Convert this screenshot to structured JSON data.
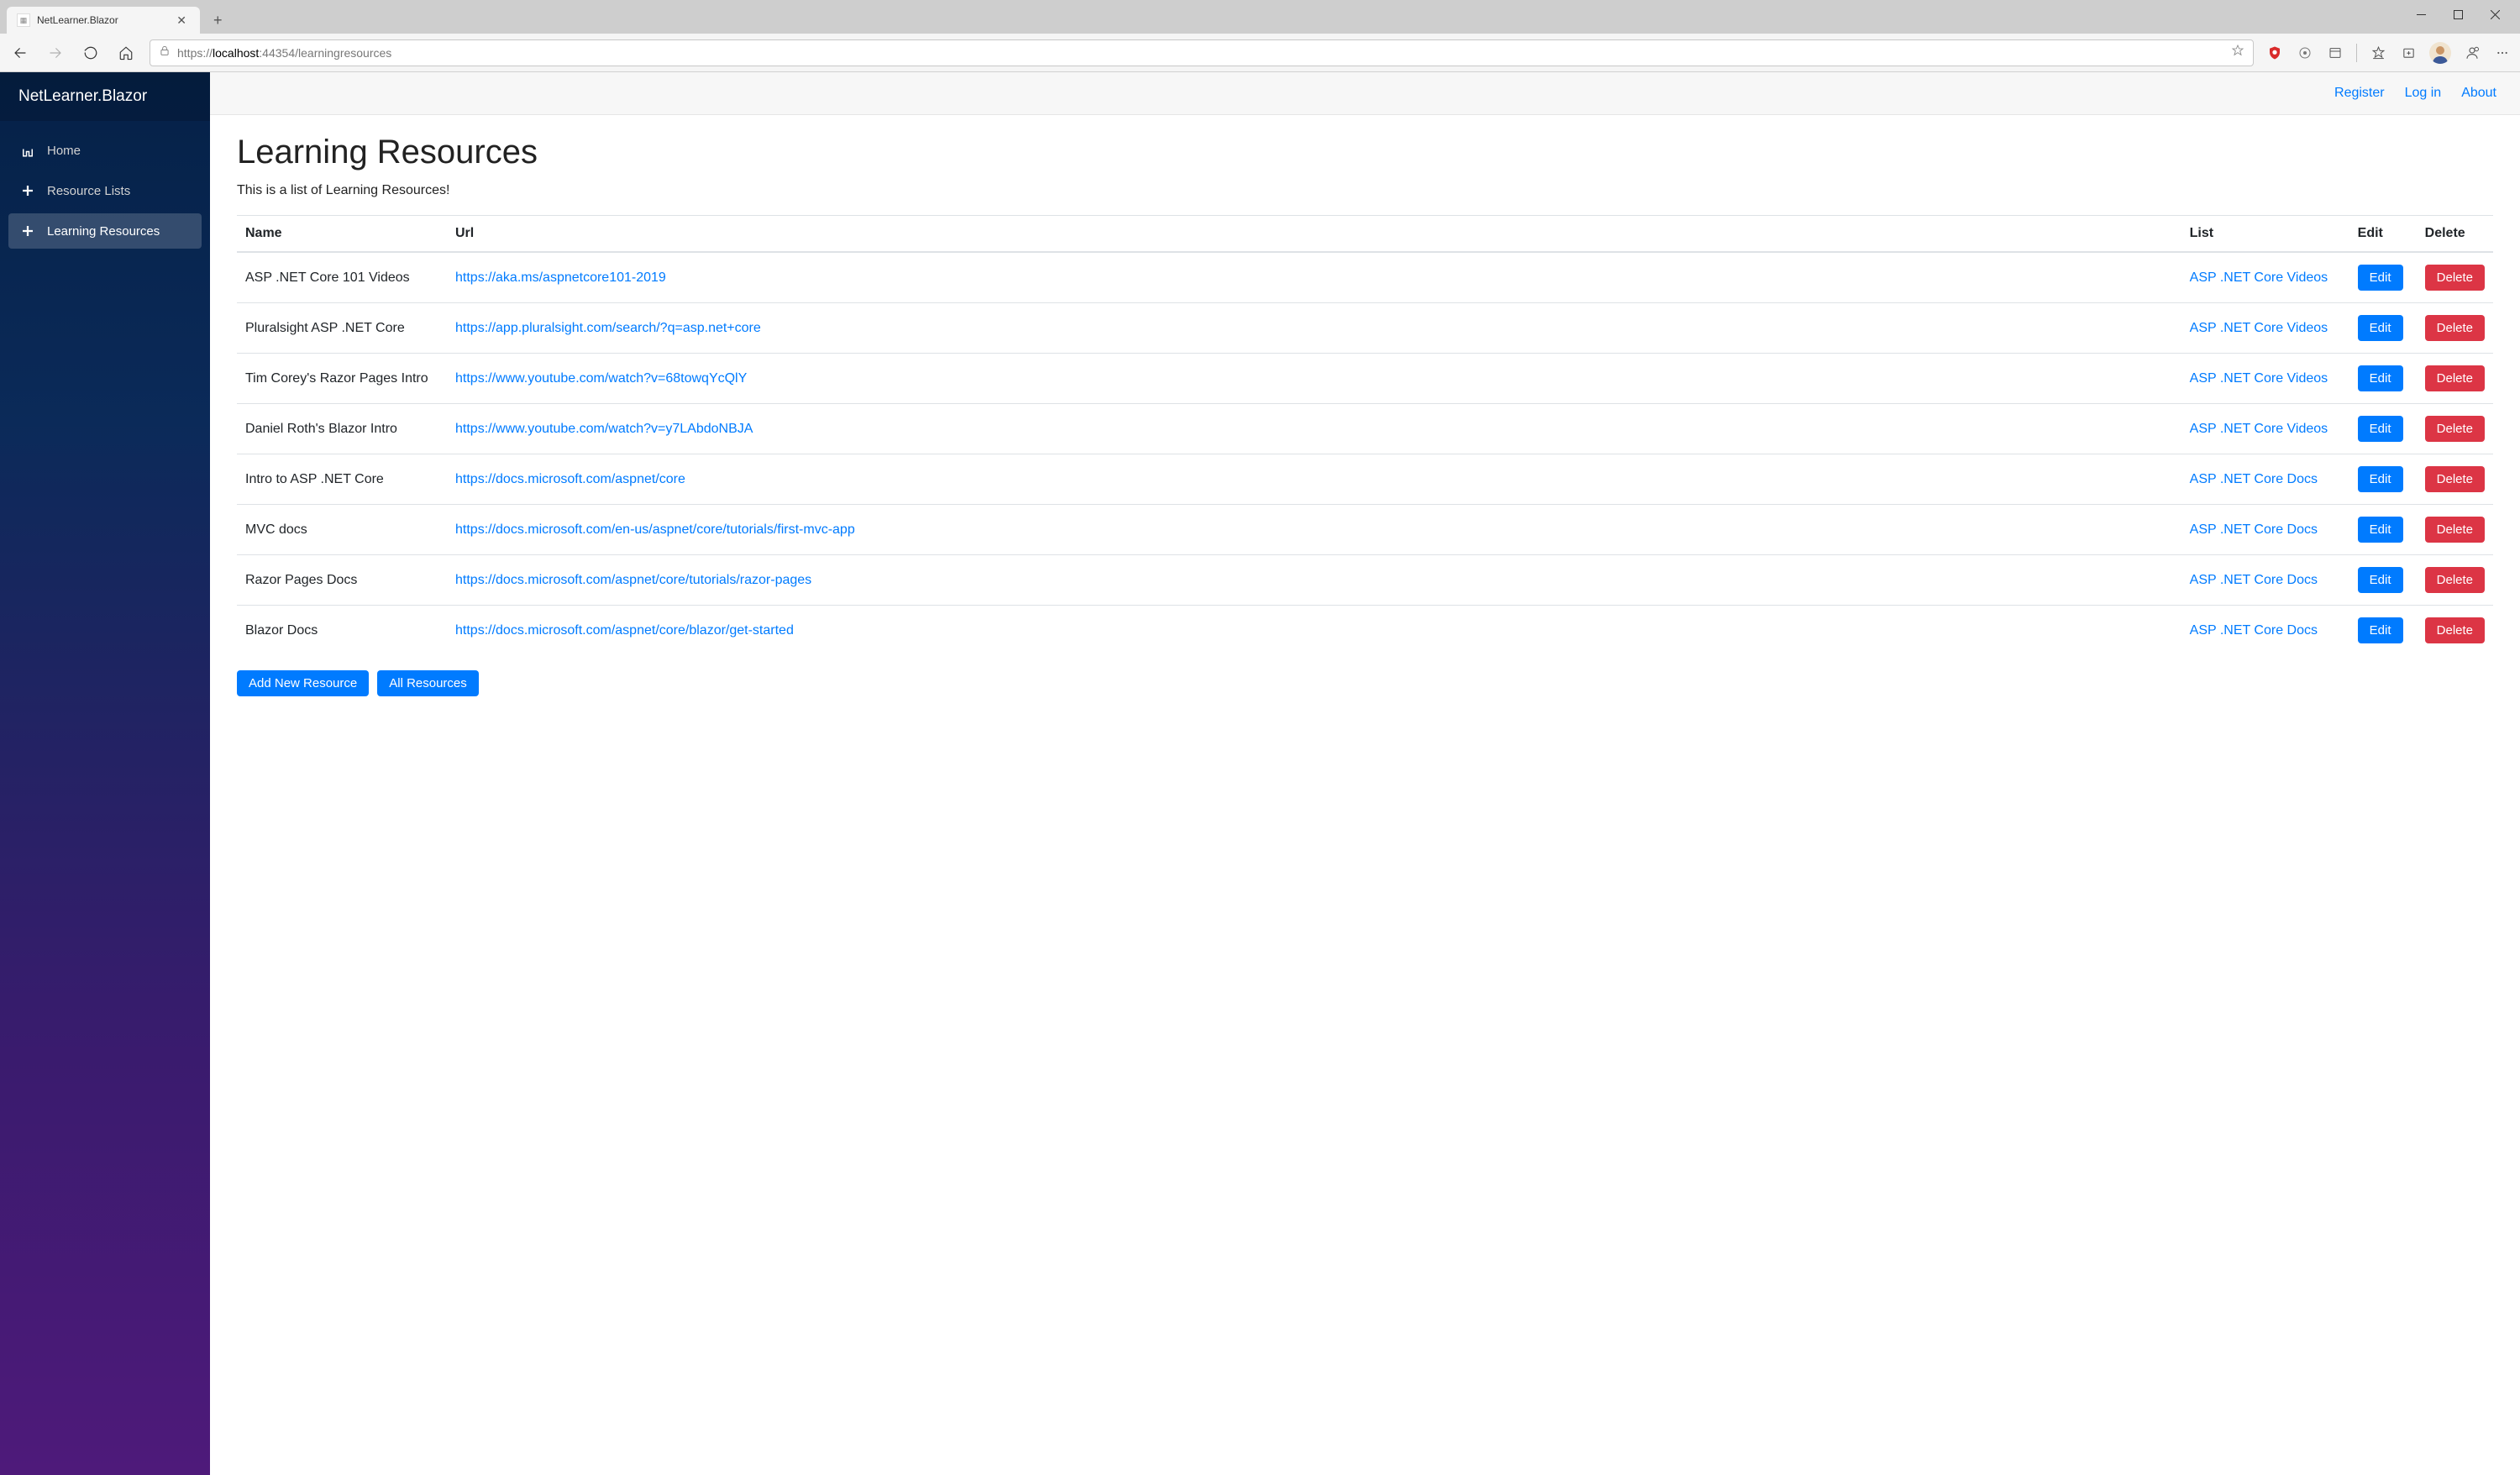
{
  "browser": {
    "tab_title": "NetLearner.Blazor",
    "url_prefix": "https://",
    "url_host": "localhost",
    "url_port_path": ":44354/learningresources"
  },
  "sidebar": {
    "brand": "NetLearner.Blazor",
    "items": [
      {
        "label": "Home",
        "icon": "home",
        "active": false
      },
      {
        "label": "Resource Lists",
        "icon": "plus",
        "active": false
      },
      {
        "label": "Learning Resources",
        "icon": "plus",
        "active": true
      }
    ]
  },
  "top_links": {
    "register": "Register",
    "login": "Log in",
    "about": "About"
  },
  "page": {
    "title": "Learning Resources",
    "description": "This is a list of Learning Resources!"
  },
  "table": {
    "headers": {
      "name": "Name",
      "url": "Url",
      "list": "List",
      "edit": "Edit",
      "delete": "Delete"
    },
    "rows": [
      {
        "name": "ASP .NET Core 101 Videos",
        "url": "https://aka.ms/aspnetcore101-2019",
        "list": "ASP .NET Core Videos"
      },
      {
        "name": "Pluralsight ASP .NET Core",
        "url": "https://app.pluralsight.com/search/?q=asp.net+core",
        "list": "ASP .NET Core Videos"
      },
      {
        "name": "Tim Corey's Razor Pages Intro",
        "url": "https://www.youtube.com/watch?v=68towqYcQlY",
        "list": "ASP .NET Core Videos"
      },
      {
        "name": "Daniel Roth's Blazor Intro",
        "url": "https://www.youtube.com/watch?v=y7LAbdoNBJA",
        "list": "ASP .NET Core Videos"
      },
      {
        "name": "Intro to ASP .NET Core",
        "url": "https://docs.microsoft.com/aspnet/core",
        "list": "ASP .NET Core Docs"
      },
      {
        "name": "MVC docs",
        "url": "https://docs.microsoft.com/en-us/aspnet/core/tutorials/first-mvc-app",
        "list": "ASP .NET Core Docs"
      },
      {
        "name": "Razor Pages Docs",
        "url": "https://docs.microsoft.com/aspnet/core/tutorials/razor-pages",
        "list": "ASP .NET Core Docs"
      },
      {
        "name": "Blazor Docs",
        "url": "https://docs.microsoft.com/aspnet/core/blazor/get-started",
        "list": "ASP .NET Core Docs"
      }
    ]
  },
  "buttons": {
    "edit": "Edit",
    "delete": "Delete",
    "add_new": "Add New Resource",
    "all_resources": "All Resources"
  }
}
